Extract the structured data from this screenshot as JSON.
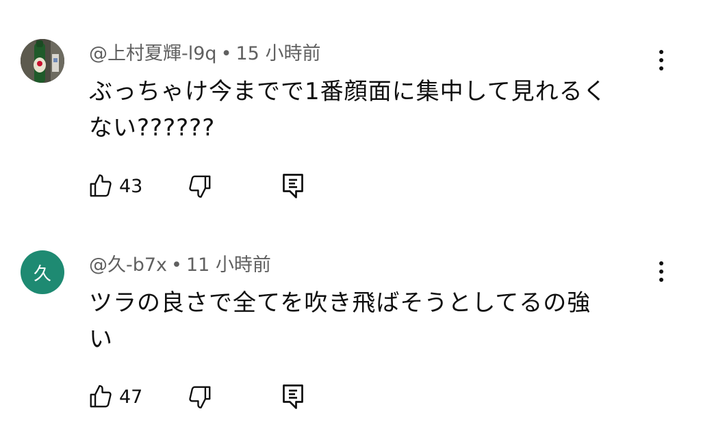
{
  "comments": [
    {
      "author": "@上村夏輝-l9q",
      "separator": "•",
      "time": "15 小時前",
      "text_line1": "ぶっちゃけ今までで1番顔面に集中して見れるく",
      "text_line2": "ない??????",
      "likes": "43",
      "avatar_type": "photo"
    },
    {
      "author": "@久-b7x",
      "separator": "•",
      "time": "11 小時前",
      "text_line1": "ツラの良さで全てを吹き飛ばそうとしてるの強",
      "text_line2": "い",
      "likes": "47",
      "avatar_type": "letter",
      "avatar_letter": "久",
      "avatar_color": "#1e8a72"
    }
  ],
  "icons": {
    "like": "thumbs-up-icon",
    "dislike": "thumbs-down-icon",
    "reply": "reply-icon",
    "more": "more-vertical-icon"
  }
}
